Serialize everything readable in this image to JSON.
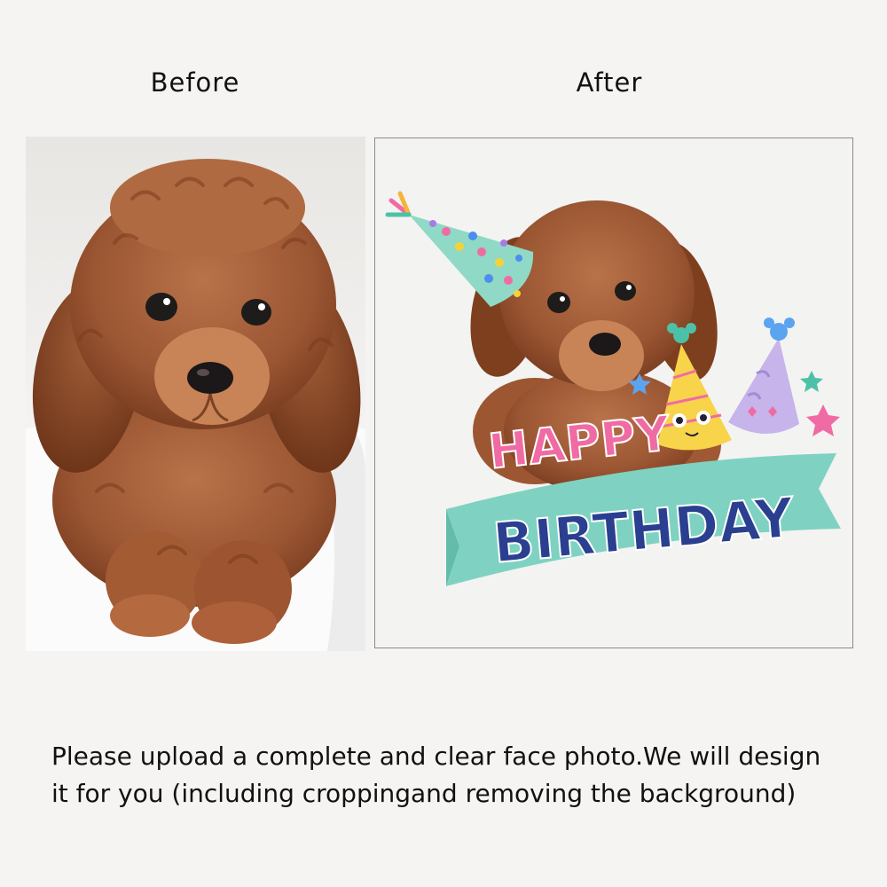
{
  "labels": {
    "before": "Before",
    "after": "After"
  },
  "graphic": {
    "happy": "HAPPY",
    "birthday": "BIRTHDAY"
  },
  "caption": {
    "line1": "Please upload a complete and clear face photo.We will design",
    "line2": "it for you (including croppingand removing the background)"
  },
  "colors": {
    "background": "#f5f4f2",
    "fur": "#a8623a",
    "banner": "#7fd2c1",
    "birthday_text": "#2a3f8f",
    "happy_text": "#f06ba3"
  }
}
